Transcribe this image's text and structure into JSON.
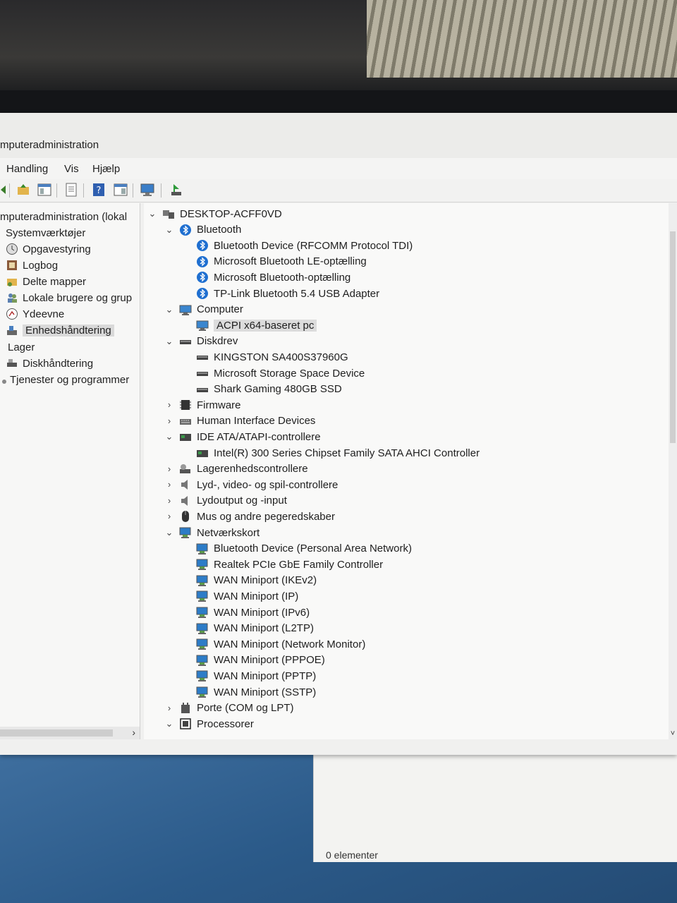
{
  "window": {
    "title": "mputeradministration"
  },
  "menu": {
    "items": [
      "Handling",
      "Vis",
      "Hjælp"
    ]
  },
  "toolbar": {
    "icons": [
      "back-icon",
      "up-folder-icon",
      "show-hide-tree-icon",
      "properties-icon",
      "help-icon",
      "show-hide-action-pane-icon",
      "monitor-icon",
      "update-driver-icon"
    ]
  },
  "nav": {
    "items": [
      {
        "label": "mputeradministration (lokal",
        "icon": "computer-management-icon"
      },
      {
        "label": "Systemværktøjer",
        "icon": "tools-icon"
      },
      {
        "label": "Opgavestyring",
        "icon": "clock-icon"
      },
      {
        "label": "Logbog",
        "icon": "event-log-icon"
      },
      {
        "label": "Delte mapper",
        "icon": "shared-folder-icon"
      },
      {
        "label": "Lokale brugere og grup",
        "icon": "users-icon"
      },
      {
        "label": "Ydeevne",
        "icon": "performance-icon"
      },
      {
        "label": "Enhedshåndtering",
        "icon": "device-manager-icon"
      },
      {
        "label": "Lager",
        "icon": "storage-icon"
      },
      {
        "label": "Diskhåndtering",
        "icon": "disk-management-icon"
      },
      {
        "label": "Tjenester og programmer",
        "icon": "services-icon"
      }
    ]
  },
  "tree": {
    "root": "DESKTOP-ACFF0VD",
    "rows": [
      {
        "label": "DESKTOP-ACFF0VD",
        "icon": "computer-icon",
        "chev": "open"
      },
      {
        "label": "Bluetooth",
        "icon": "bluetooth-icon",
        "chev": "open"
      },
      {
        "label": "Bluetooth Device (RFCOMM Protocol TDI)",
        "icon": "bluetooth-icon",
        "chev": ""
      },
      {
        "label": "Microsoft Bluetooth LE-optælling",
        "icon": "bluetooth-icon",
        "chev": ""
      },
      {
        "label": "Microsoft Bluetooth-optælling",
        "icon": "bluetooth-icon",
        "chev": ""
      },
      {
        "label": "TP-Link Bluetooth 5.4 USB Adapter",
        "icon": "bluetooth-icon",
        "chev": ""
      },
      {
        "label": "Computer",
        "icon": "monitor-icon",
        "chev": "open"
      },
      {
        "label": "ACPI x64-baseret pc",
        "icon": "monitor-icon",
        "chev": ""
      },
      {
        "label": "Diskdrev",
        "icon": "disk-drive-icon",
        "chev": "open"
      },
      {
        "label": "KINGSTON SA400S37960G",
        "icon": "disk-drive-icon",
        "chev": ""
      },
      {
        "label": "Microsoft Storage Space Device",
        "icon": "disk-drive-icon",
        "chev": ""
      },
      {
        "label": "Shark Gaming 480GB SSD",
        "icon": "disk-drive-icon",
        "chev": ""
      },
      {
        "label": "Firmware",
        "icon": "firmware-icon",
        "chev": "closed"
      },
      {
        "label": "Human Interface Devices",
        "icon": "hid-icon",
        "chev": "closed"
      },
      {
        "label": "IDE ATA/ATAPI-controllere",
        "icon": "ide-controller-icon",
        "chev": "open"
      },
      {
        "label": "Intel(R) 300 Series Chipset Family SATA AHCI Controller",
        "icon": "ide-controller-icon",
        "chev": ""
      },
      {
        "label": "Lagerenhedscontrollere",
        "icon": "storage-controller-icon",
        "chev": "closed"
      },
      {
        "label": "Lyd-, video- og spil-controllere",
        "icon": "speaker-icon",
        "chev": "closed"
      },
      {
        "label": "Lydoutput og -input",
        "icon": "speaker-icon",
        "chev": "closed"
      },
      {
        "label": "Mus og andre pegeredskaber",
        "icon": "mouse-icon",
        "chev": "closed"
      },
      {
        "label": "Netværkskort",
        "icon": "network-adapter-icon",
        "chev": "open"
      },
      {
        "label": "Bluetooth Device (Personal Area Network)",
        "icon": "network-adapter-icon",
        "chev": ""
      },
      {
        "label": "Realtek PCIe GbE Family Controller",
        "icon": "network-adapter-icon",
        "chev": ""
      },
      {
        "label": "WAN Miniport (IKEv2)",
        "icon": "network-adapter-icon",
        "chev": ""
      },
      {
        "label": "WAN Miniport (IP)",
        "icon": "network-adapter-icon",
        "chev": ""
      },
      {
        "label": "WAN Miniport (IPv6)",
        "icon": "network-adapter-icon",
        "chev": ""
      },
      {
        "label": "WAN Miniport (L2TP)",
        "icon": "network-adapter-icon",
        "chev": ""
      },
      {
        "label": "WAN Miniport (Network Monitor)",
        "icon": "network-adapter-icon",
        "chev": ""
      },
      {
        "label": "WAN Miniport (PPPOE)",
        "icon": "network-adapter-icon",
        "chev": ""
      },
      {
        "label": "WAN Miniport (PPTP)",
        "icon": "network-adapter-icon",
        "chev": ""
      },
      {
        "label": "WAN Miniport (SSTP)",
        "icon": "network-adapter-icon",
        "chev": ""
      },
      {
        "label": "Porte (COM og LPT)",
        "icon": "port-icon",
        "chev": "closed"
      },
      {
        "label": "Processorer",
        "icon": "processor-icon",
        "chev": "open"
      }
    ]
  },
  "status": {
    "back_window": "0 elementer"
  }
}
